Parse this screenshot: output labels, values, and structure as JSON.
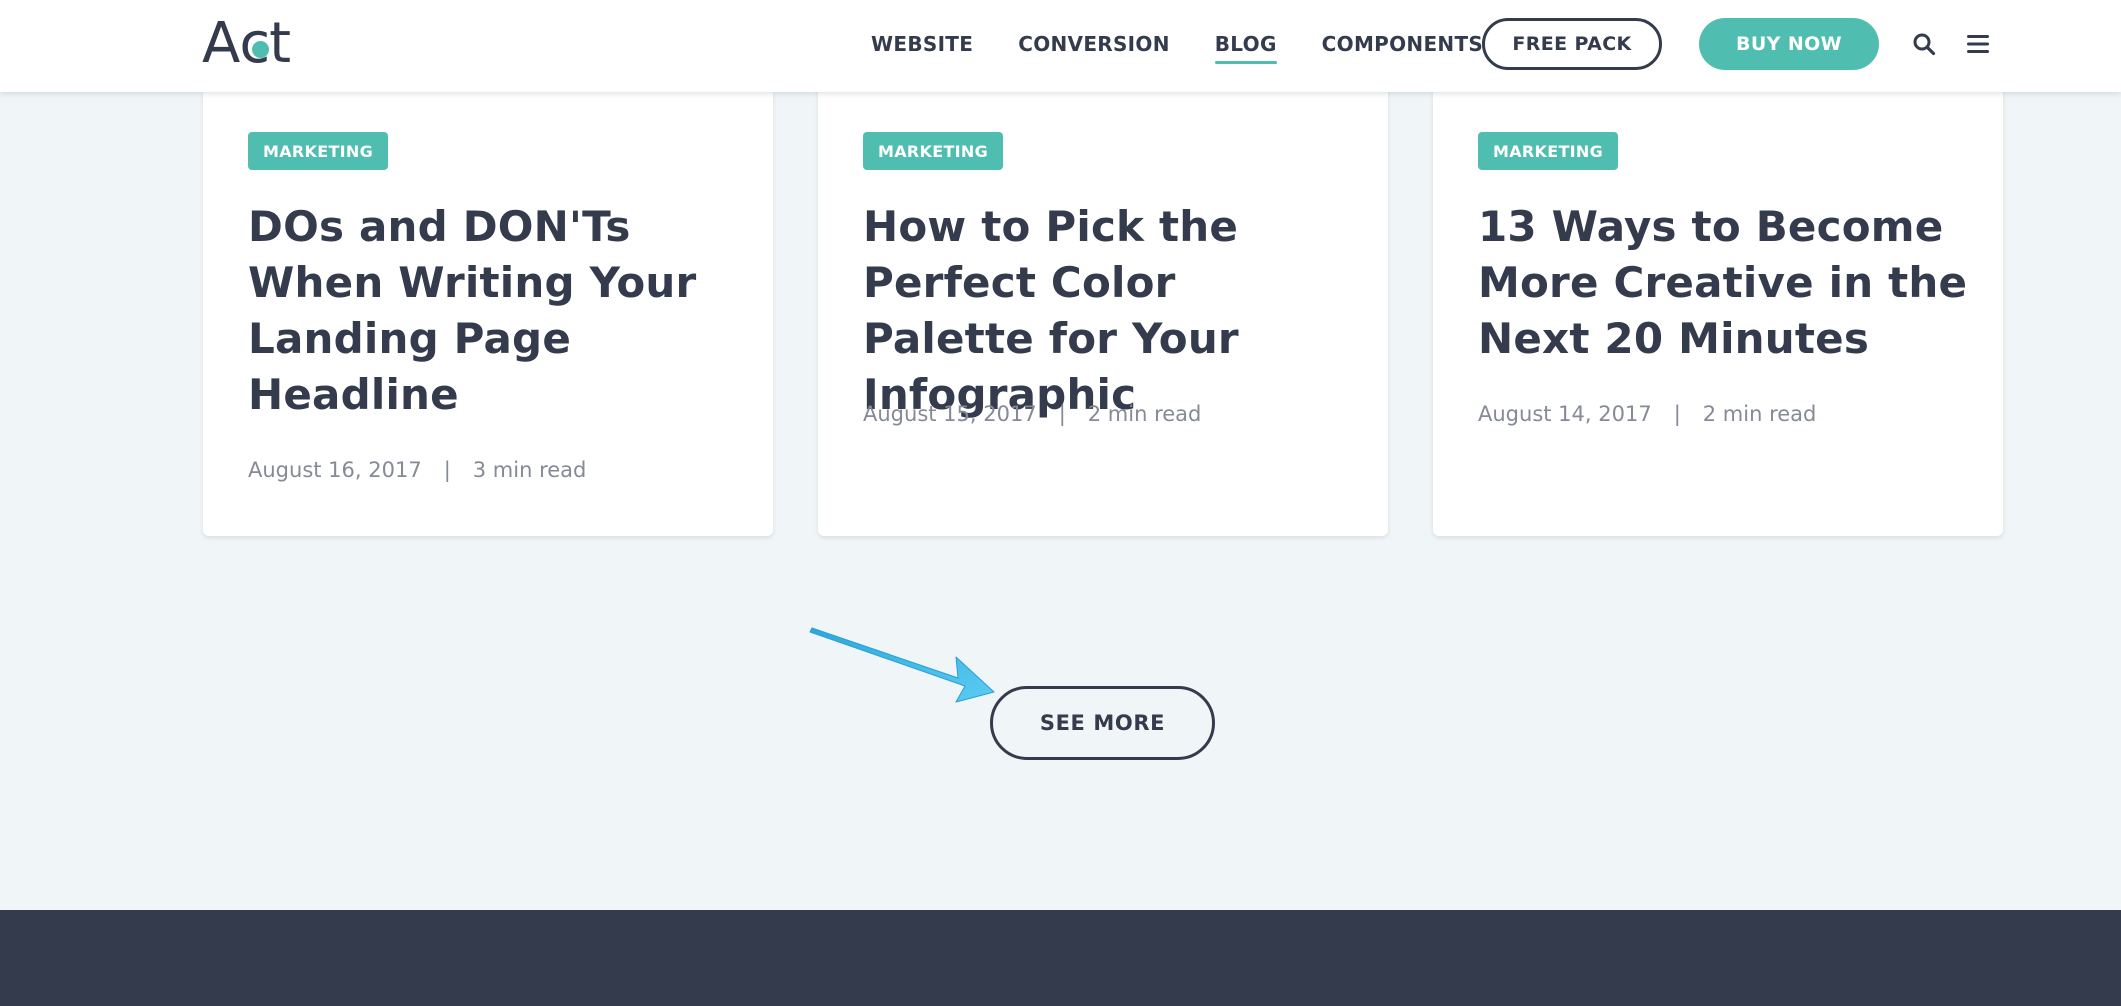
{
  "header": {
    "logo": {
      "text_a": "A",
      "text_c": "c",
      "text_t": "t"
    },
    "nav": [
      {
        "label": "WEBSITE",
        "active": false
      },
      {
        "label": "CONVERSION",
        "active": false
      },
      {
        "label": "BLOG",
        "active": true
      },
      {
        "label": "COMPONENTS",
        "active": false
      }
    ],
    "free_pack_label": "FREE PACK",
    "buy_now_label": "BUY NOW",
    "icons": {
      "search": "search-icon",
      "menu": "hamburger-menu-icon"
    }
  },
  "posts": [
    {
      "tag": "MARKETING",
      "title": "DOs and DON'Ts When Writing Your Landing Page Headline",
      "date": "August 16, 2017",
      "read_time": "3 min read"
    },
    {
      "tag": "MARKETING",
      "title": "How to Pick the Perfect Color Palette for Your Infographic",
      "date": "August 15, 2017",
      "read_time": "2 min read"
    },
    {
      "tag": "MARKETING",
      "title": "13 Ways to Become More Creative in the Next 20 Minutes",
      "date": "August 14, 2017",
      "read_time": "2 min read"
    }
  ],
  "meta_separator": "|",
  "see_more_label": "SEE MORE",
  "colors": {
    "accent": "#4fbeb1",
    "text_dark": "#333b4d",
    "text_muted": "#858a96",
    "background": "#f0f5f7",
    "footer": "#333b4d",
    "annotation_arrow": "#3ab4e6"
  }
}
